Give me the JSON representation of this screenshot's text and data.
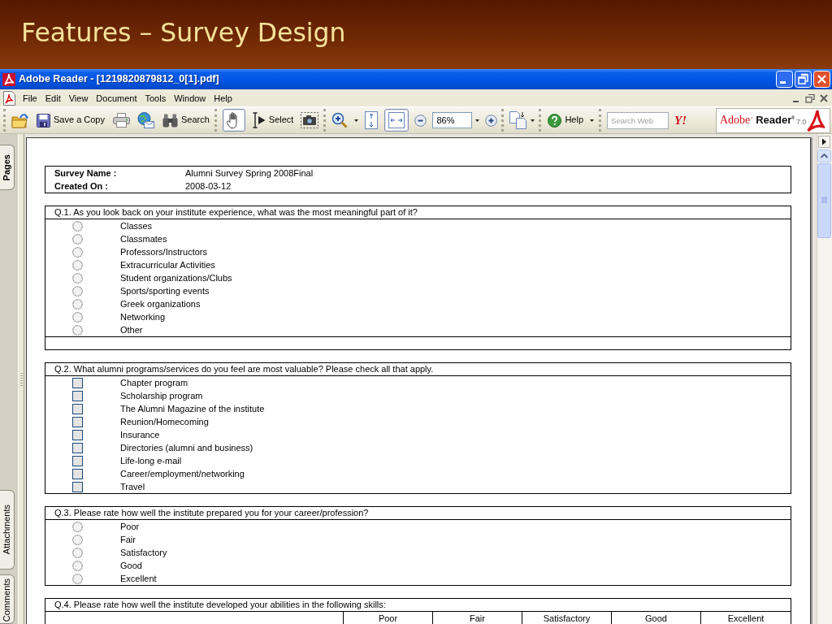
{
  "slide": {
    "title": "Features – Survey Design"
  },
  "window": {
    "title": "Adobe Reader - [1219820879812_0[1].pdf]"
  },
  "menu": [
    "File",
    "Edit",
    "View",
    "Document",
    "Tools",
    "Window",
    "Help"
  ],
  "toolbar": {
    "save_copy": "Save a Copy",
    "search": "Search",
    "tools": [
      {
        "kind": "hand",
        "selected": true
      },
      {
        "kind": "select",
        "label": "Select",
        "selected": false
      },
      {
        "kind": "snapshot",
        "selected": false
      }
    ],
    "views": [
      {
        "kind": "fit-page",
        "selected": false
      },
      {
        "kind": "fit-width",
        "selected": true
      }
    ],
    "zoom": "86%",
    "help": "Help",
    "search_web": {
      "placeholder": "Search Web"
    },
    "web_logo": "Y!",
    "brand": {
      "name": "Adobe$^{®}$",
      "product": "Reader$^{®}$",
      "version": "7.0"
    }
  },
  "side_panel": {
    "top_tabs": [
      {
        "label": "Pages",
        "selected": true
      }
    ],
    "bottom_tabs": [
      {
        "label": "Attachments",
        "selected": false
      },
      {
        "label": "Comments",
        "selected": false
      }
    ]
  },
  "document": {
    "header": [
      {
        "label": "Survey Name :",
        "value": "Alumni Survey Spring 2008Final"
      },
      {
        "label": "Created On :",
        "value": "2008-03-12"
      }
    ],
    "questions": [
      {
        "kind": "radio",
        "text": "Q.1. As you look back on your institute experience, what was the most meaningful part of it?",
        "answer_box": true,
        "options": [
          {
            "label": "Classes",
            "selected": false
          },
          {
            "label": "Classmates",
            "selected": false
          },
          {
            "label": "Professors/Instructors",
            "selected": false
          },
          {
            "label": "Extracurricular Activities",
            "selected": false
          },
          {
            "label": "Student organizations/Clubs",
            "selected": false
          },
          {
            "label": "Sports/sporting events",
            "selected": false
          },
          {
            "label": "Greek organizations",
            "selected": false
          },
          {
            "label": "Networking",
            "selected": false
          },
          {
            "label": "Other",
            "selected": false
          }
        ]
      },
      {
        "kind": "checkbox",
        "text": "Q.2. What alumni programs/services do you feel are most valuable? Please check all that apply.",
        "answer_box": false,
        "options": [
          {
            "label": "Chapter program",
            "checked": false
          },
          {
            "label": "Scholarship program",
            "checked": false
          },
          {
            "label": "The Alumni Magazine of the institute",
            "checked": false
          },
          {
            "label": "Reunion/Homecoming",
            "checked": false
          },
          {
            "label": "Insurance",
            "checked": false
          },
          {
            "label": "Directories (alumni and business)",
            "checked": false
          },
          {
            "label": "Life-long e-mail",
            "checked": false
          },
          {
            "label": "Career/employment/networking",
            "checked": false
          },
          {
            "label": "Travel",
            "checked": false
          }
        ]
      },
      {
        "kind": "radio",
        "text": "Q.3. Please rate how well the institute prepared you for your career/profession?",
        "answer_box": false,
        "options": [
          {
            "label": "Poor",
            "selected": false
          },
          {
            "label": "Fair",
            "selected": false
          },
          {
            "label": "Satisfactory",
            "selected": false
          },
          {
            "label": "Good",
            "selected": false
          },
          {
            "label": "Excellent",
            "selected": false
          }
        ]
      },
      {
        "kind": "matrix",
        "text": "Q.4. Please rate how well the institute developed your abilities in the following skills:",
        "columns": [
          "Poor",
          "Fair",
          "Satisfactory",
          "Good",
          "Excellent"
        ]
      }
    ]
  }
}
